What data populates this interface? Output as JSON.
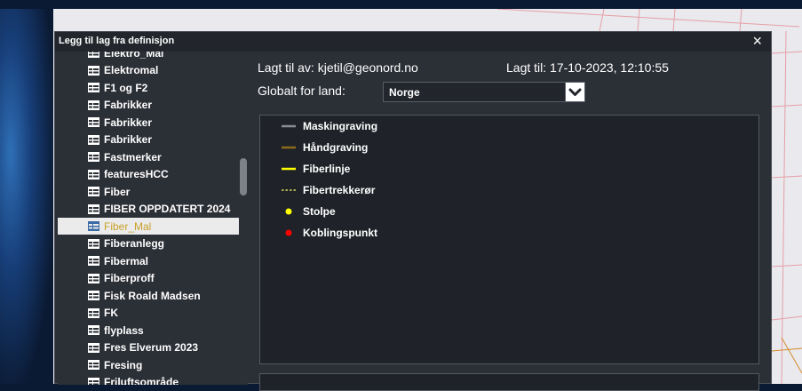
{
  "dialog": {
    "title": "Legg til lag fra definisjon",
    "close_label": "×"
  },
  "layer_list": [
    {
      "label": "Elektro_Mal"
    },
    {
      "label": "Elektromal"
    },
    {
      "label": "F1 og F2"
    },
    {
      "label": "Fabrikker"
    },
    {
      "label": "Fabrikker"
    },
    {
      "label": "Fabrikker"
    },
    {
      "label": "Fastmerker"
    },
    {
      "label": "featuresHCC"
    },
    {
      "label": "Fiber"
    },
    {
      "label": "FIBER OPPDATERT 2024"
    },
    {
      "label": "Fiber_Mal",
      "selected": true
    },
    {
      "label": "Fiberanlegg"
    },
    {
      "label": "Fibermal"
    },
    {
      "label": "Fiberproff"
    },
    {
      "label": "Fisk Roald Madsen"
    },
    {
      "label": "FK"
    },
    {
      "label": "flyplass"
    },
    {
      "label": "Fres Elverum 2023"
    },
    {
      "label": "Fresing"
    },
    {
      "label": "Friluftsområde"
    }
  ],
  "details": {
    "added_by_label": "Lagt til av: kjetil@geonord.no",
    "added_at_label": "Lagt til: 17-10-2023, 12:10:55",
    "global_label": "Globalt for land:",
    "country_value": "Norge"
  },
  "legend": [
    {
      "label": "Maskingraving",
      "symbol": "line",
      "color": "#8a8d91"
    },
    {
      "label": "Håndgraving",
      "symbol": "line",
      "color": "#8b6b1a"
    },
    {
      "label": "Fiberlinje",
      "symbol": "line",
      "color": "#ffff00"
    },
    {
      "label": "Fibertrekkerør",
      "symbol": "dashed",
      "color": "#ffff66"
    },
    {
      "label": "Stolpe",
      "symbol": "dot",
      "color": "#ffff00"
    },
    {
      "label": "Koblingspunkt",
      "symbol": "dot",
      "color": "#ff0000"
    }
  ],
  "colors": {
    "dialog_bg": "#2b2f36",
    "selected_text": "#c8a02a"
  }
}
